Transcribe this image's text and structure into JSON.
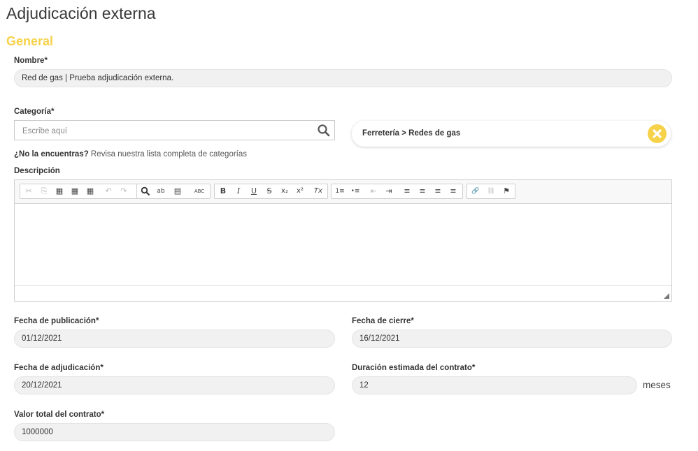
{
  "page": {
    "title": "Adjudicación externa",
    "section_title": "General"
  },
  "nombre": {
    "label": "Nombre*",
    "value": "Red de gas | Prueba adjudicación externa."
  },
  "categoria": {
    "label": "Categoría*",
    "placeholder": "Escribe aquí",
    "selected": "Ferretería > Redes de gas",
    "hint_bold": "¿No la encuentras?",
    "hint_text": "Revisa nuestra lista completa de categorías"
  },
  "descripcion": {
    "label": "Descripción",
    "toolbar": {
      "cut": "✂",
      "copy": "⎘",
      "paste": "📋",
      "paste_text": "T",
      "paste_word": "W",
      "undo": "↶",
      "redo": "↷",
      "find": "🔍",
      "replace": "ab",
      "select_all": "▤",
      "spellcheck": "ABC",
      "bold": "B",
      "italic": "I",
      "underline": "U",
      "strike": "S",
      "subscript": "x₂",
      "superscript": "x²",
      "remove_format": "Tx",
      "ordered_list": "1≡",
      "bullet_list": "•≡",
      "outdent": "⇤",
      "indent": "⇥",
      "align_left": "≡",
      "align_center": "≡",
      "align_right": "≡",
      "justify": "≡",
      "link": "🔗",
      "unlink": "⛓",
      "anchor": "⚑"
    }
  },
  "fecha_publicacion": {
    "label": "Fecha de publicación*",
    "value": "01/12/2021"
  },
  "fecha_cierre": {
    "label": "Fecha de cierre*",
    "value": "16/12/2021"
  },
  "fecha_adjudicacion": {
    "label": "Fecha de adjudicación*",
    "value": "20/12/2021"
  },
  "duracion": {
    "label": "Duración estimada del contrato*",
    "value": "12",
    "unit": "meses"
  },
  "valor_total": {
    "label": "Valor total del contrato*",
    "value": "1000000"
  },
  "colors": {
    "accent": "#f6d24a",
    "field_bg": "#f1f1f1"
  }
}
